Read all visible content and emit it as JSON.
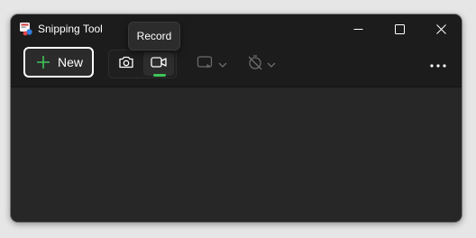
{
  "window": {
    "title": "Snipping Tool",
    "app_icon": "snipping-tool-icon",
    "controls": {
      "minimize_icon": "minimize-icon",
      "maximize_icon": "maximize-icon",
      "close_icon": "close-icon"
    }
  },
  "toolbar": {
    "new_label": "New",
    "new_icon": "plus-icon",
    "modes": [
      {
        "icon": "camera-icon",
        "active": false
      },
      {
        "icon": "video-camera-icon",
        "active": true
      }
    ],
    "tooltip": "Record",
    "snip_area_icon": "rectangle-snip-icon",
    "delay_icon": "no-timer-icon",
    "more_icon": "more-options-icon"
  },
  "colors": {
    "accent_green": "#3ec45a",
    "window_bg": "#272727",
    "titlebar_bg": "#1c1c1c",
    "disabled_icon": "#6b6b6b"
  }
}
